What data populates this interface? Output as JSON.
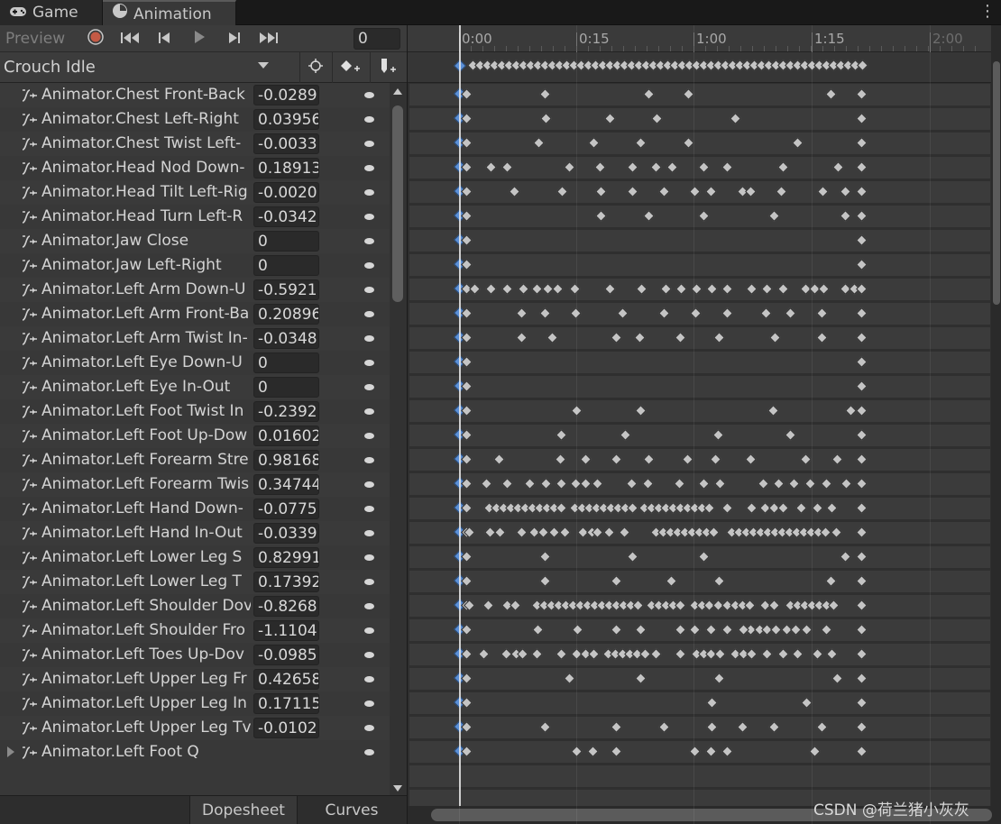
{
  "tabs": {
    "game": "Game",
    "animation": "Animation"
  },
  "toolbar": {
    "preview_label": "Preview",
    "frame_value": "0"
  },
  "clip": {
    "name": "Crouch Idle"
  },
  "ruler": {
    "labels": [
      "0:00",
      "0:15",
      "1:00",
      "1:15",
      "2:00"
    ]
  },
  "properties": [
    {
      "name": "Animator.Chest Front-Back",
      "value": "-0.0289"
    },
    {
      "name": "Animator.Chest Left-Right",
      "value": "0.03956"
    },
    {
      "name": "Animator.Chest Twist Left-",
      "value": "-0.0033"
    },
    {
      "name": "Animator.Head Nod Down-",
      "value": "0.18913"
    },
    {
      "name": "Animator.Head Tilt Left-Rig",
      "value": "-0.0020"
    },
    {
      "name": "Animator.Head Turn Left-R",
      "value": "-0.0342"
    },
    {
      "name": "Animator.Jaw Close",
      "value": "0"
    },
    {
      "name": "Animator.Jaw Left-Right",
      "value": "0"
    },
    {
      "name": "Animator.Left Arm Down-U",
      "value": "-0.5921"
    },
    {
      "name": "Animator.Left Arm Front-Ba",
      "value": "0.20896"
    },
    {
      "name": "Animator.Left Arm Twist In-",
      "value": "-0.0348"
    },
    {
      "name": "Animator.Left Eye Down-U",
      "value": "0"
    },
    {
      "name": "Animator.Left Eye In-Out",
      "value": "0"
    },
    {
      "name": "Animator.Left Foot Twist In",
      "value": "-0.2392"
    },
    {
      "name": "Animator.Left Foot Up-Dow",
      "value": "0.01602"
    },
    {
      "name": "Animator.Left Forearm Stre",
      "value": "0.98168"
    },
    {
      "name": "Animator.Left Forearm Twis",
      "value": "0.34744"
    },
    {
      "name": "Animator.Left Hand Down-",
      "value": "-0.0775"
    },
    {
      "name": "Animator.Left Hand In-Out",
      "value": "-0.0339"
    },
    {
      "name": "Animator.Left Lower Leg S",
      "value": "0.82991"
    },
    {
      "name": "Animator.Left Lower Leg T",
      "value": "0.17392"
    },
    {
      "name": "Animator.Left Shoulder Dov",
      "value": "-0.8268"
    },
    {
      "name": "Animator.Left Shoulder Fro",
      "value": "-1.1104"
    },
    {
      "name": "Animator.Left Toes Up-Dov",
      "value": "-0.0985"
    },
    {
      "name": "Animator.Left Upper Leg Fr",
      "value": "0.42658"
    },
    {
      "name": "Animator.Left Upper Leg In",
      "value": "0.17115"
    },
    {
      "name": "Animator.Left Upper Leg Tv",
      "value": "-0.0102"
    },
    {
      "name": "Animator.Left Foot Q",
      "value": ""
    }
  ],
  "bottom_tabs": {
    "dopesheet": "Dopesheet",
    "curves": "Curves"
  },
  "watermark": "CSDN @荷兰猪小灰灰"
}
